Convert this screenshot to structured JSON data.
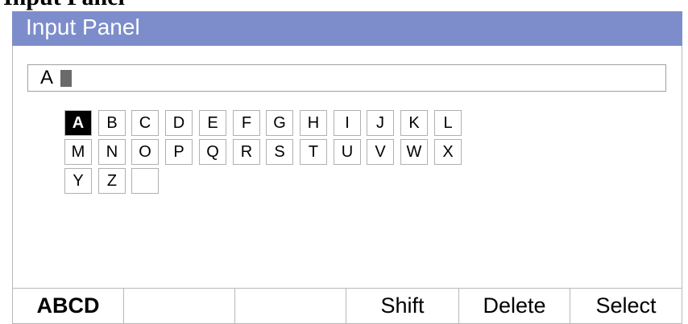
{
  "header_partial_text": "Input Panel",
  "panel": {
    "title": "Input Panel"
  },
  "input": {
    "value": "A"
  },
  "keyboard": {
    "selected": "A",
    "rows": [
      [
        "A",
        "B",
        "C",
        "D",
        "E",
        "F",
        "G",
        "H",
        "I",
        "J",
        "K",
        "L"
      ],
      [
        "M",
        "N",
        "O",
        "P",
        "Q",
        "R",
        "S",
        "T",
        "U",
        "V",
        "W",
        "X"
      ],
      [
        "Y",
        "Z",
        ""
      ]
    ]
  },
  "footer": {
    "buttons": [
      {
        "label": "ABCD"
      },
      {
        "label": ""
      },
      {
        "label": ""
      },
      {
        "label": "Shift"
      },
      {
        "label": "Delete"
      },
      {
        "label": "Select"
      }
    ]
  },
  "colors": {
    "title_bar": "#7d8dcb",
    "title_text": "#ffffff",
    "selected_key_bg": "#000000",
    "cursor": "#6a6a6a",
    "border": "#b8b8b8"
  }
}
